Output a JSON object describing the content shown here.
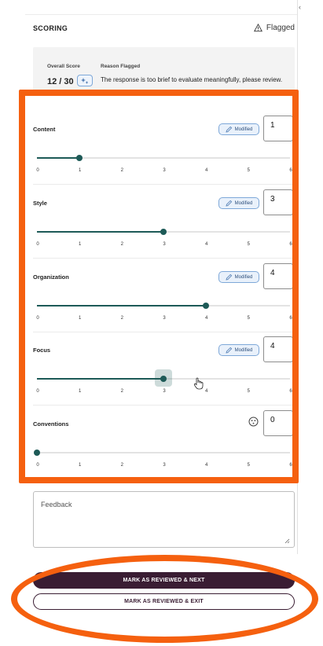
{
  "header": {
    "title": "SCORING",
    "flag_status": "Flagged",
    "tick_mark": "‹"
  },
  "summary": {
    "overall_label": "Overall Score",
    "overall_value": "12 / 30",
    "reason_label": "Reason Flagged",
    "reason_text": "The response is too brief to evaluate meaningfully, please review."
  },
  "scale": {
    "ticks": [
      "0",
      "1",
      "2",
      "3",
      "4",
      "5",
      "6"
    ],
    "max": 6
  },
  "traits": [
    {
      "name": "Content",
      "badge": "Modified",
      "score": "1",
      "value": 1,
      "badge_type": "modified"
    },
    {
      "name": "Style",
      "badge": "Modified",
      "score": "3",
      "value": 3,
      "badge_type": "modified"
    },
    {
      "name": "Organization",
      "badge": "Modified",
      "score": "4",
      "value": 4,
      "badge_type": "modified"
    },
    {
      "name": "Focus",
      "badge": "Modified",
      "score": "4",
      "value": 3,
      "badge_type": "modified",
      "hover": true
    },
    {
      "name": "Conventions",
      "badge": "",
      "score": "0",
      "value": 0,
      "badge_type": "ai"
    }
  ],
  "feedback": {
    "label": "Feedback",
    "value": ""
  },
  "actions": {
    "next_label": "MARK AS REVIEWED & NEXT",
    "exit_label": "MARK AS REVIEWED & EXIT"
  },
  "colors": {
    "accent": "#1d5a57",
    "primary_button": "#3a1d33",
    "annotation": "#f5600f",
    "badge_border": "#7ea8d8"
  }
}
